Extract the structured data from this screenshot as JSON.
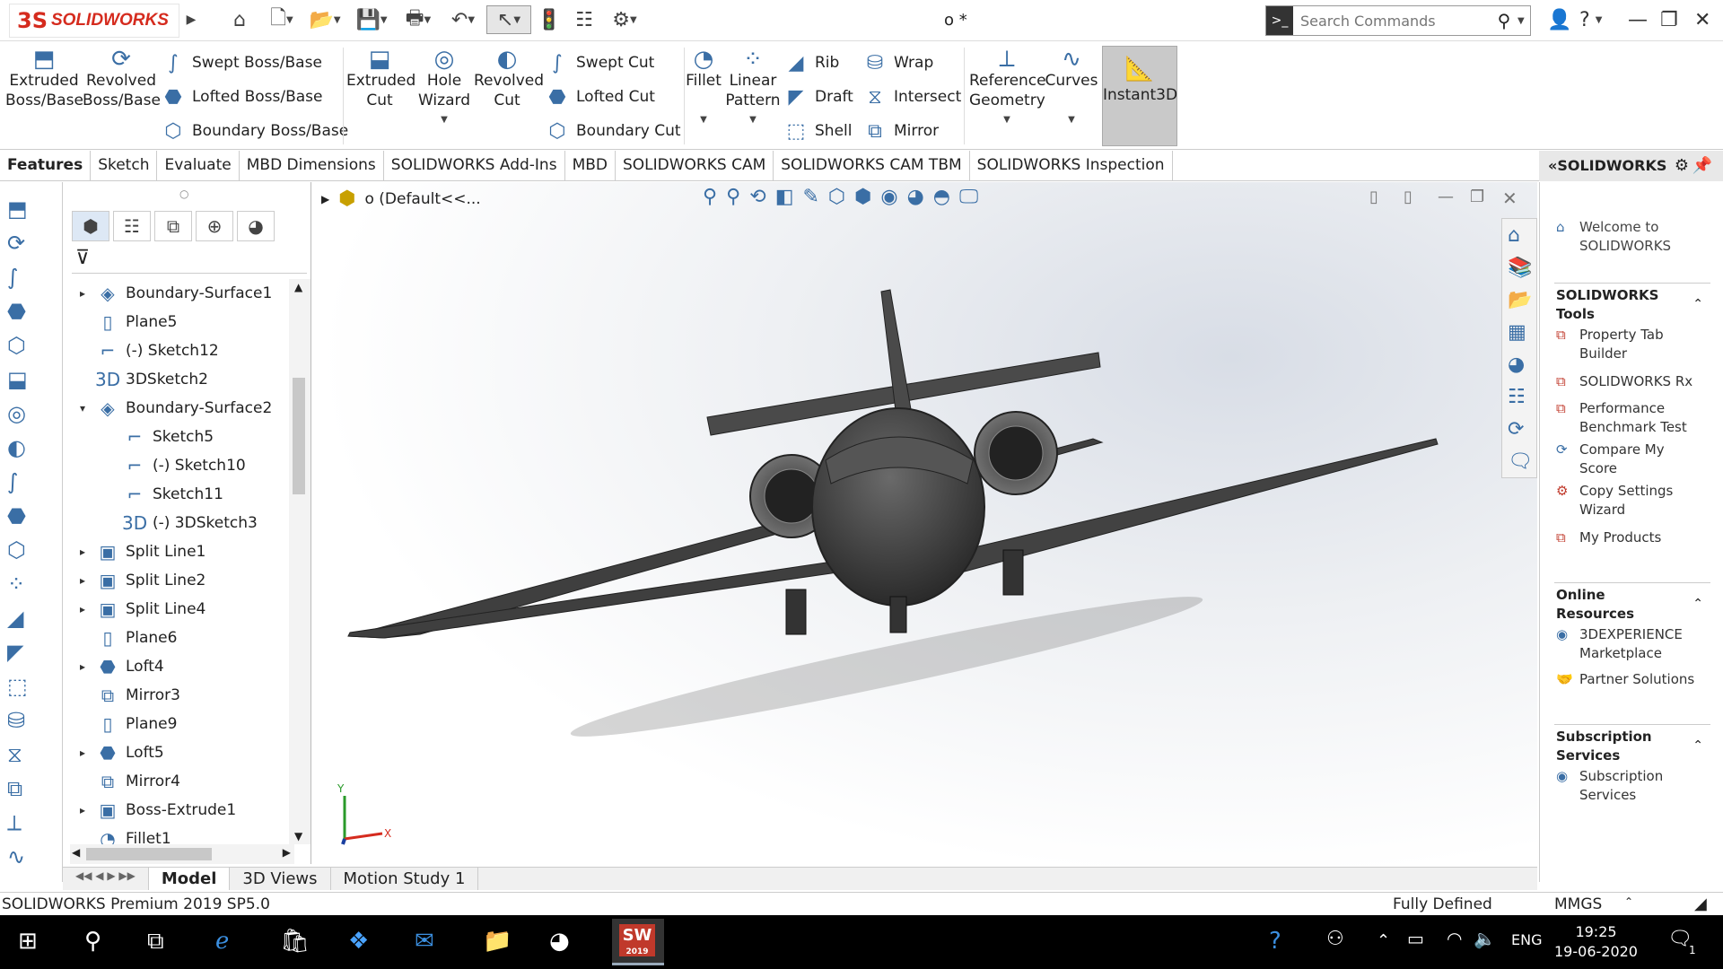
{
  "app": {
    "brand_ds": "3S",
    "brand": "SOLIDWORKS",
    "doc_title": "o *"
  },
  "search": {
    "placeholder": "Search Commands"
  },
  "ribbon": {
    "extruded_boss": "Extruded Boss/Base",
    "revolved_boss": "Revolved Boss/Base",
    "swept_boss": "Swept Boss/Base",
    "lofted_boss": "Lofted Boss/Base",
    "boundary_boss": "Boundary Boss/Base",
    "extruded_cut": "Extruded Cut",
    "hole_wizard": "Hole Wizard",
    "revolved_cut": "Revolved Cut",
    "swept_cut": "Swept Cut",
    "lofted_cut": "Lofted Cut",
    "boundary_cut": "Boundary Cut",
    "fillet": "Fillet",
    "linear_pattern": "Linear Pattern",
    "rib": "Rib",
    "draft": "Draft",
    "shell": "Shell",
    "wrap": "Wrap",
    "intersect": "Intersect",
    "mirror": "Mirror",
    "reference_geometry": "Reference Geometry",
    "curves": "Curves",
    "instant3d": "Instant3D"
  },
  "tabs": [
    "Features",
    "Sketch",
    "Evaluate",
    "MBD Dimensions",
    "SOLIDWORKS Add-Ins",
    "MBD",
    "SOLIDWORKS CAM",
    "SOLIDWORKS CAM TBM",
    "SOLIDWORKS Inspection"
  ],
  "tree_header": "o (Default<<...",
  "tree": [
    {
      "label": "Boundary-Surface1",
      "expander": "▸",
      "icon": "◈",
      "indent": 0
    },
    {
      "label": "Plane5",
      "expander": "",
      "icon": "▯",
      "indent": 0
    },
    {
      "label": "(-) Sketch12",
      "expander": "",
      "icon": "⌐",
      "indent": 0
    },
    {
      "label": "3DSketch2",
      "expander": "",
      "icon": "3D",
      "indent": 0
    },
    {
      "label": "Boundary-Surface2",
      "expander": "▾",
      "icon": "◈",
      "indent": 0
    },
    {
      "label": "Sketch5",
      "expander": "",
      "icon": "⌐",
      "indent": 1
    },
    {
      "label": "(-) Sketch10",
      "expander": "",
      "icon": "⌐",
      "indent": 1
    },
    {
      "label": "Sketch11",
      "expander": "",
      "icon": "⌐",
      "indent": 1
    },
    {
      "label": "(-) 3DSketch3",
      "expander": "",
      "icon": "3D",
      "indent": 1
    },
    {
      "label": "Split Line1",
      "expander": "▸",
      "icon": "▣",
      "indent": 0
    },
    {
      "label": "Split Line2",
      "expander": "▸",
      "icon": "▣",
      "indent": 0
    },
    {
      "label": "Split Line4",
      "expander": "▸",
      "icon": "▣",
      "indent": 0
    },
    {
      "label": "Plane6",
      "expander": "",
      "icon": "▯",
      "indent": 0
    },
    {
      "label": "Loft4",
      "expander": "▸",
      "icon": "⬣",
      "indent": 0
    },
    {
      "label": "Mirror3",
      "expander": "",
      "icon": "⧉",
      "indent": 0
    },
    {
      "label": "Plane9",
      "expander": "",
      "icon": "▯",
      "indent": 0
    },
    {
      "label": "Loft5",
      "expander": "▸",
      "icon": "⬣",
      "indent": 0
    },
    {
      "label": "Mirror4",
      "expander": "",
      "icon": "⧉",
      "indent": 0
    },
    {
      "label": "Boss-Extrude1",
      "expander": "▸",
      "icon": "▣",
      "indent": 0
    },
    {
      "label": "Fillet1",
      "expander": "",
      "icon": "◔",
      "indent": 0
    }
  ],
  "right_panel": {
    "title": "SOLIDWORKS",
    "welcome": "Welcome to SOLIDWORKS",
    "tools_head": "SOLIDWORKS Tools",
    "tools": [
      "Property Tab Builder",
      "SOLIDWORKS Rx",
      "Performance Benchmark Test",
      "Compare My Score",
      "Copy Settings Wizard",
      "My Products"
    ],
    "online_head": "Online Resources",
    "online": [
      "3DEXPERIENCE Marketplace",
      "Partner Solutions"
    ],
    "sub_head": "Subscription Services",
    "sub": [
      "Subscription Services"
    ]
  },
  "bottom_tabs": [
    "Model",
    "3D Views",
    "Motion Study 1"
  ],
  "status": {
    "version": "SOLIDWORKS Premium 2019 SP5.0",
    "state": "Fully Defined",
    "units": "MMGS"
  },
  "triad": {
    "y": "Y",
    "x": "X"
  },
  "taskbar": {
    "lang": "ENG",
    "time": "19:25",
    "date": "19-06-2020",
    "notif": "1",
    "sw_badge": "2019"
  }
}
